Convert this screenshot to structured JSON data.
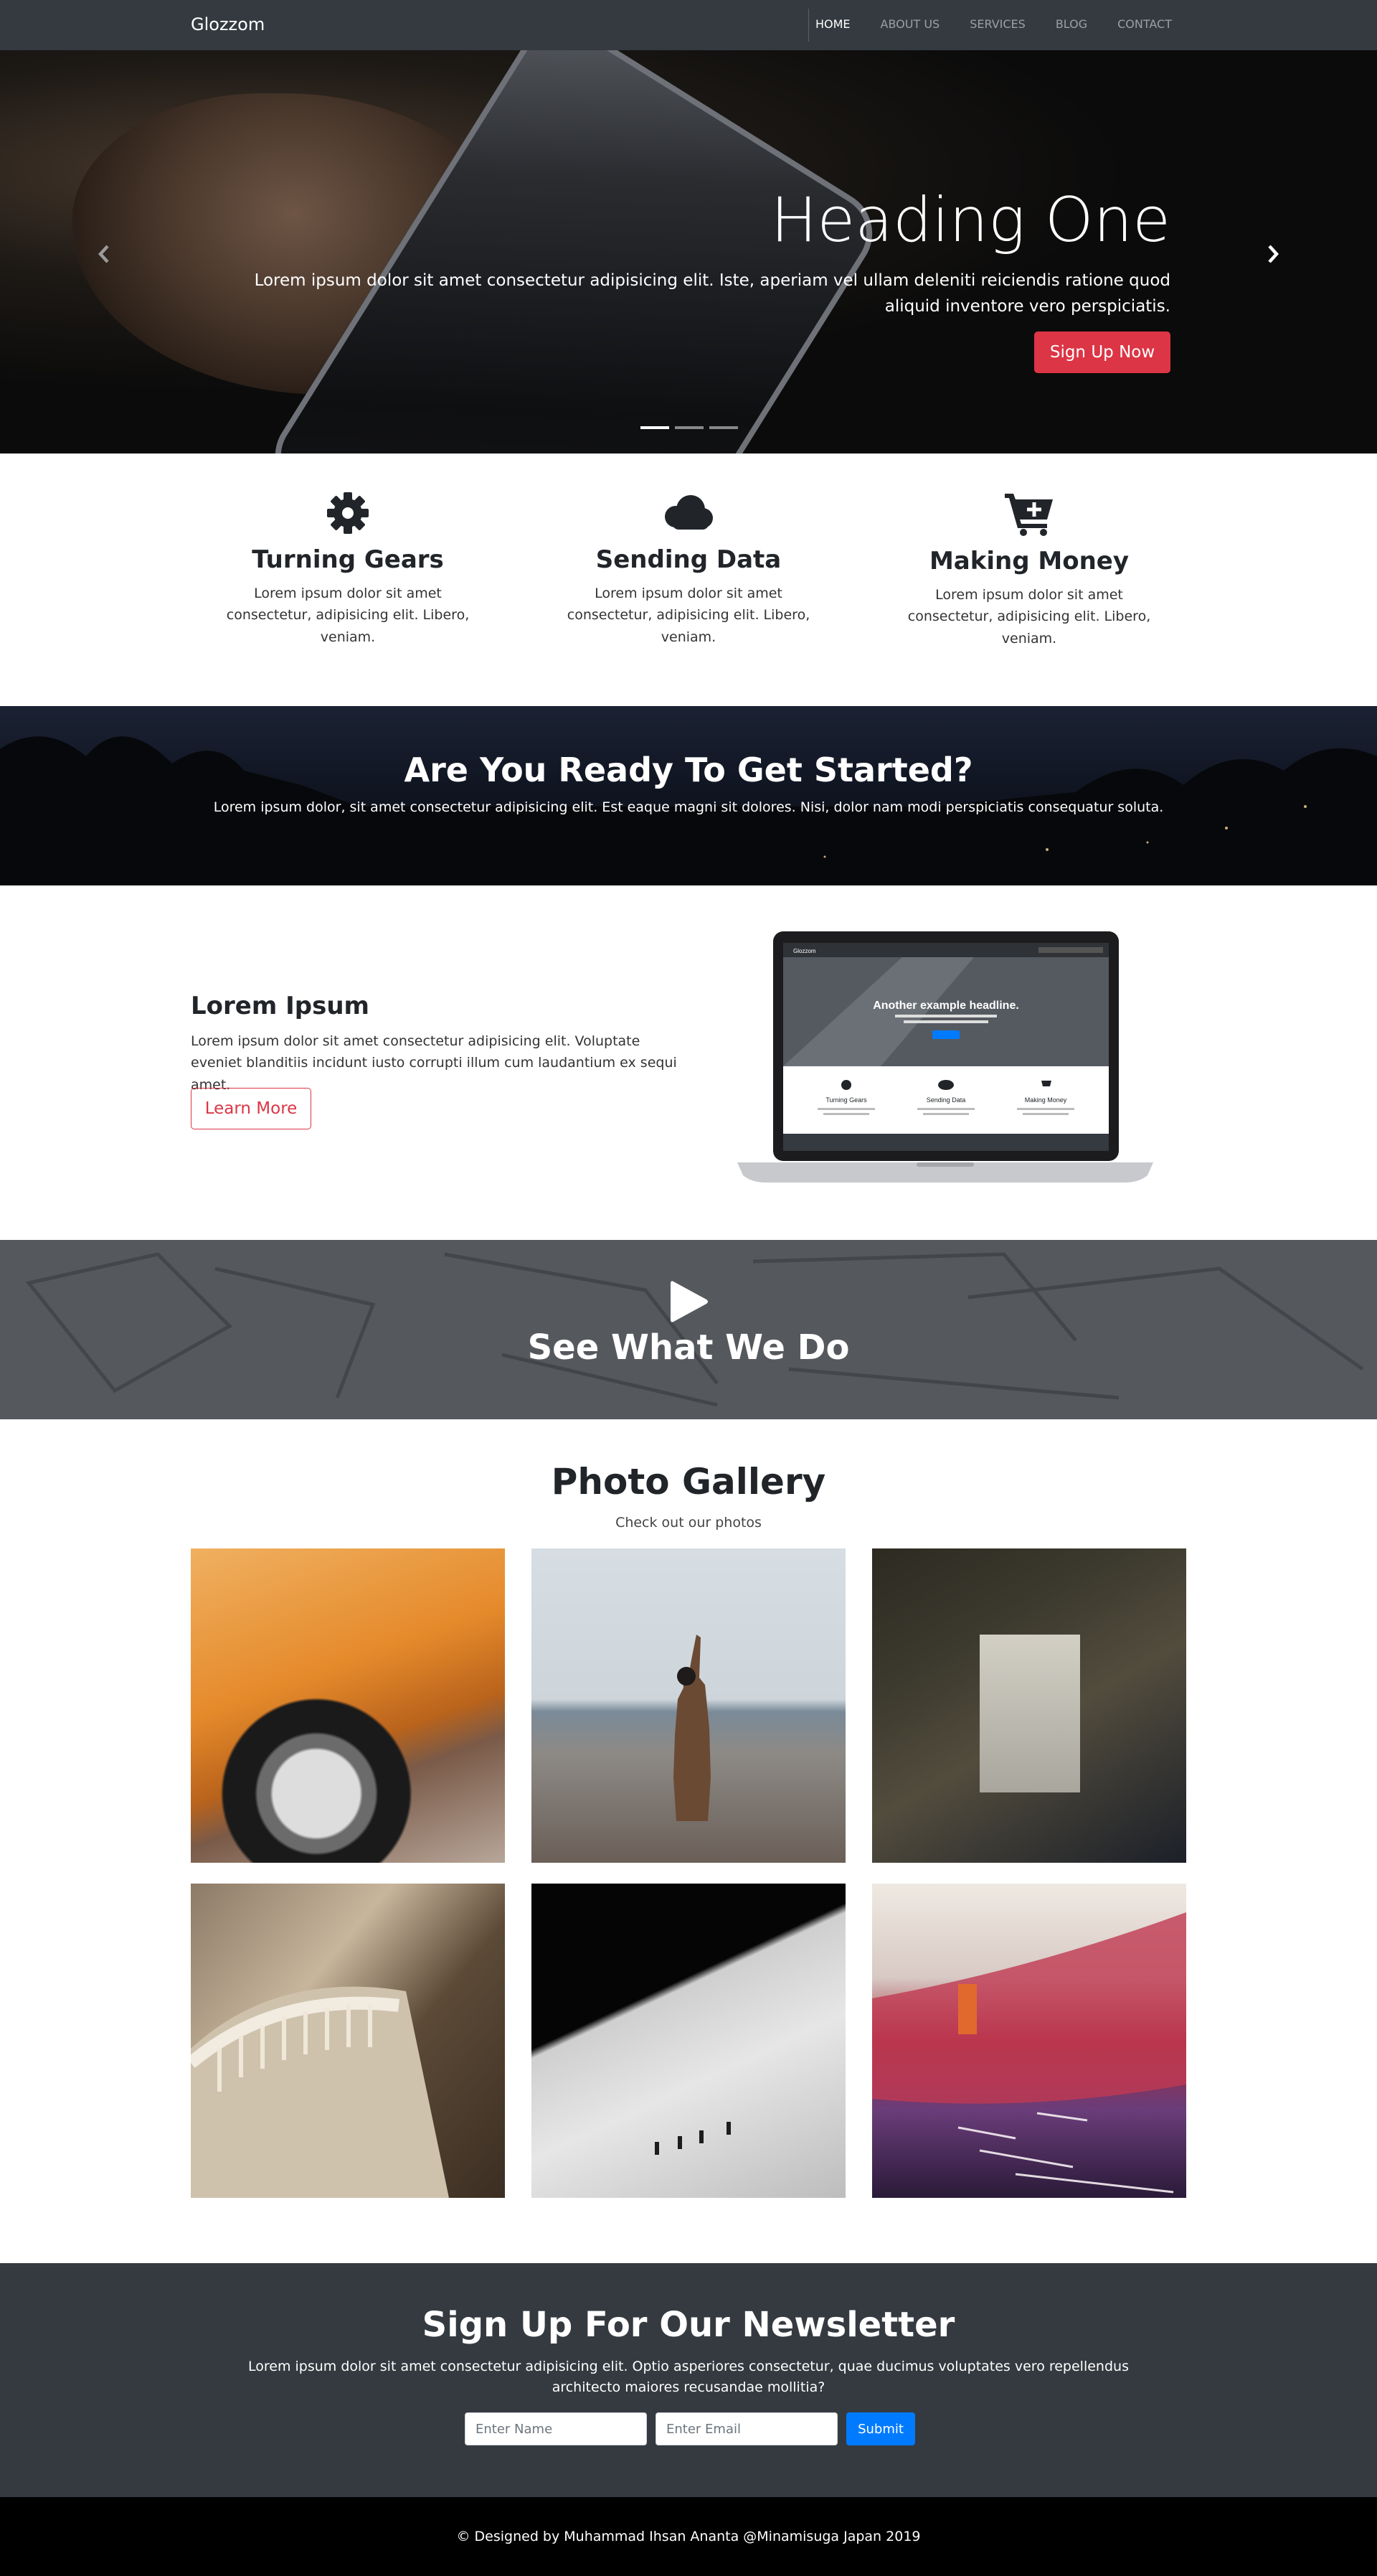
{
  "navbar": {
    "brand": "Glozzom",
    "links": [
      {
        "label": "HOME",
        "active": true
      },
      {
        "label": "ABOUT US",
        "active": false
      },
      {
        "label": "SERVICES",
        "active": false
      },
      {
        "label": "BLOG",
        "active": false
      },
      {
        "label": "CONTACT",
        "active": false
      }
    ]
  },
  "hero": {
    "heading": "Heading One",
    "text": "Lorem ipsum dolor sit amet consectetur adipisicing elit. Iste, aperiam vel ullam deleniti reiciendis ratione quod aliquid inventore vero perspiciatis.",
    "button_label": "Sign Up Now",
    "prev_icon": "chevron-left-icon",
    "next_icon": "chevron-right-icon",
    "slide_count": 3,
    "active_slide": 1
  },
  "features": [
    {
      "icon": "gear-icon",
      "title": "Turning Gears",
      "text": "Lorem ipsum dolor sit amet consectetur, adipisicing elit. Libero, veniam."
    },
    {
      "icon": "cloud-icon",
      "title": "Sending Data",
      "text": "Lorem ipsum dolor sit amet consectetur, adipisicing elit. Libero, veniam."
    },
    {
      "icon": "cart-plus-icon",
      "title": "Making Money",
      "text": "Lorem ipsum dolor sit amet consectetur, adipisicing elit. Libero, veniam."
    }
  ],
  "get_started": {
    "title": "Are You Ready To Get Started?",
    "text": "Lorem ipsum dolor, sit amet consectetur adipisicing elit. Est eaque magni sit dolores. Nisi, dolor nam modi perspiciatis consequatur soluta."
  },
  "info": {
    "title": "Lorem Ipsum",
    "text": "Lorem ipsum dolor sit amet consectetur adipisicing elit. Voluptate eveniet blanditiis incidunt iusto corrupti illum cum laudantium ex sequi amet.",
    "button_label": "Learn More",
    "laptop_screen": {
      "brand": "Glozzom",
      "headline": "Another example headline.",
      "features": [
        "Turning Gears",
        "Sending Data",
        "Making Money"
      ]
    }
  },
  "video": {
    "icon": "play-icon",
    "title": "See What We Do"
  },
  "gallery": {
    "title": "Photo Gallery",
    "subtitle": "Check out our photos"
  },
  "newsletter": {
    "title": "Sign Up For Our Newsletter",
    "text": "Lorem ipsum dolor sit amet consectetur adipisicing elit. Optio asperiores consectetur, quae ducimus voluptates vero repellendus architecto maiores recusandae mollitia?",
    "name_placeholder": "Enter Name",
    "email_placeholder": "Enter Email",
    "submit_label": "Submit"
  },
  "footer": {
    "text": "© Designed by Muhammad Ihsan Ananta @Minamisuga Japan 2019"
  },
  "colors": {
    "dark": "#343a40",
    "danger": "#dc3545",
    "primary": "#007bff"
  }
}
